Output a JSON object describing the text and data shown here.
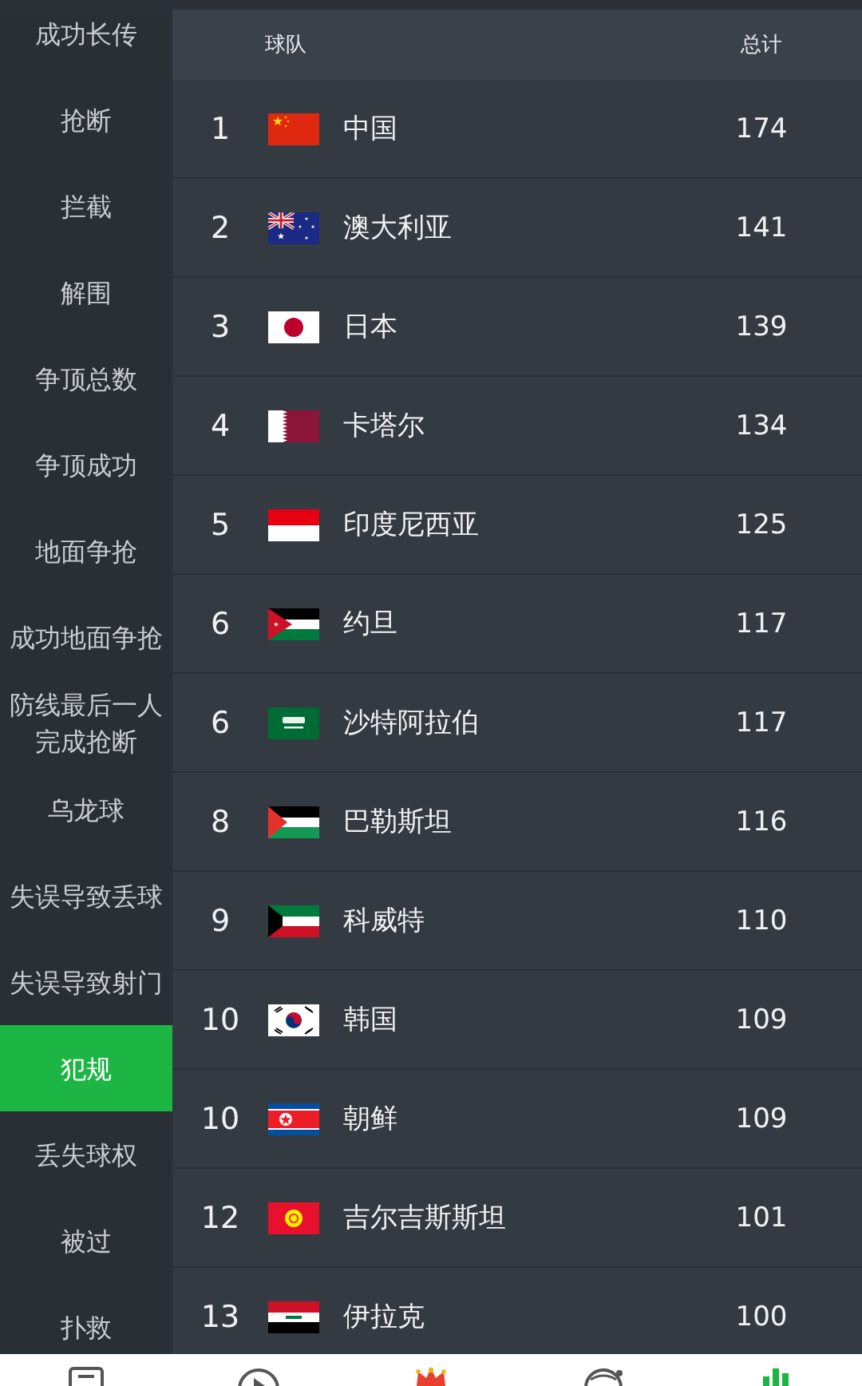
{
  "sidebar": {
    "items": [
      {
        "label": "成功长传",
        "selected": false
      },
      {
        "label": "抢断",
        "selected": false
      },
      {
        "label": "拦截",
        "selected": false
      },
      {
        "label": "解围",
        "selected": false
      },
      {
        "label": "争顶总数",
        "selected": false
      },
      {
        "label": "争顶成功",
        "selected": false
      },
      {
        "label": "地面争抢",
        "selected": false
      },
      {
        "label": "成功地面争抢",
        "selected": false
      },
      {
        "label": "防线最后一人完成抢断",
        "selected": false
      },
      {
        "label": "乌龙球",
        "selected": false
      },
      {
        "label": "失误导致丢球",
        "selected": false
      },
      {
        "label": "失误导致射门",
        "selected": false
      },
      {
        "label": "犯规",
        "selected": true
      },
      {
        "label": "丢失球权",
        "selected": false
      },
      {
        "label": "被过",
        "selected": false
      },
      {
        "label": "扑救",
        "selected": false
      }
    ]
  },
  "table": {
    "columns": [
      "球队",
      "总计"
    ],
    "rows": [
      {
        "rank": "1",
        "kind": "cn",
        "team": "中国",
        "total": "174"
      },
      {
        "rank": "2",
        "kind": "au",
        "team": "澳大利亚",
        "total": "141"
      },
      {
        "rank": "3",
        "kind": "jp",
        "team": "日本",
        "total": "139"
      },
      {
        "rank": "4",
        "kind": "qa",
        "team": "卡塔尔",
        "total": "134"
      },
      {
        "rank": "5",
        "kind": "id",
        "team": "印度尼西亚",
        "total": "125"
      },
      {
        "rank": "6",
        "kind": "jo",
        "team": "约旦",
        "total": "117"
      },
      {
        "rank": "6",
        "kind": "sa",
        "team": "沙特阿拉伯",
        "total": "117"
      },
      {
        "rank": "8",
        "kind": "ps",
        "team": "巴勒斯坦",
        "total": "116"
      },
      {
        "rank": "9",
        "kind": "kw",
        "team": "科威特",
        "total": "110"
      },
      {
        "rank": "10",
        "kind": "kr",
        "team": "韩国",
        "total": "109"
      },
      {
        "rank": "10",
        "kind": "kp",
        "team": "朝鲜",
        "total": "109"
      },
      {
        "rank": "12",
        "kind": "kg",
        "team": "吉尔吉斯斯坦",
        "total": "101"
      },
      {
        "rank": "13",
        "kind": "iq",
        "team": "伊拉克",
        "total": "100"
      }
    ]
  },
  "bottom_nav": {
    "items": [
      {
        "kind": "doc",
        "selected": false
      },
      {
        "kind": "play",
        "selected": false
      },
      {
        "kind": "crown",
        "selected": false
      },
      {
        "kind": "ball",
        "selected": false
      },
      {
        "kind": "chart",
        "selected": true
      }
    ]
  }
}
